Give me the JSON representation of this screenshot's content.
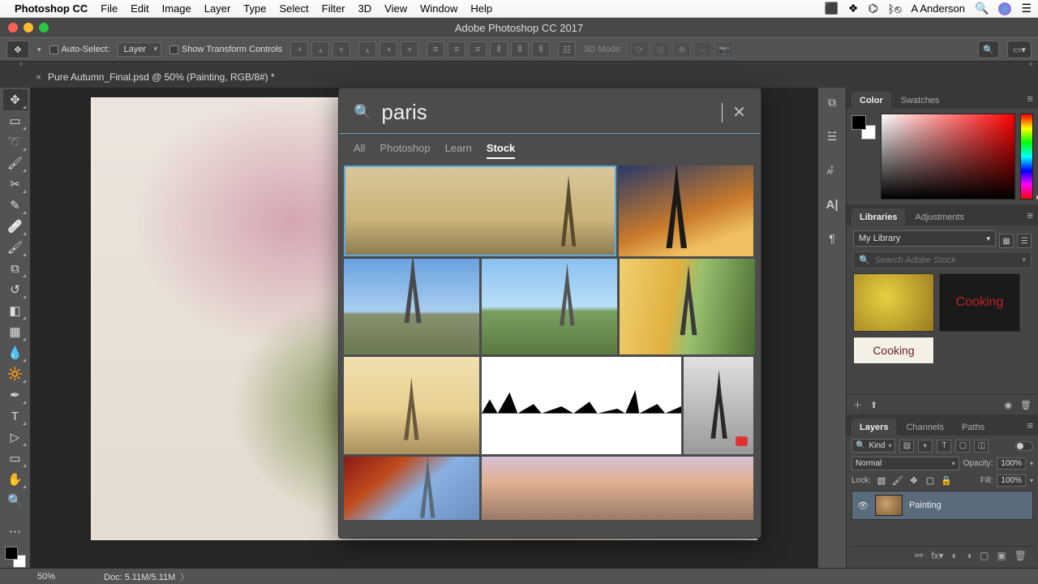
{
  "menubar": {
    "app_name": "Photoshop CC",
    "items": [
      "File",
      "Edit",
      "Image",
      "Layer",
      "Type",
      "Select",
      "Filter",
      "3D",
      "View",
      "Window",
      "Help"
    ],
    "user": "A Anderson"
  },
  "window": {
    "title": "Adobe Photoshop CC 2017"
  },
  "options_bar": {
    "auto_select_label": "Auto-Select:",
    "auto_select_target": "Layer",
    "show_transform_label": "Show Transform Controls",
    "threeD_label": "3D Mode:"
  },
  "doc_tab": {
    "label": "Pure Autumn_Final.psd @ 50% (Painting, RGB/8#) *"
  },
  "search_panel": {
    "query": "paris",
    "tabs": [
      "All",
      "Photoshop",
      "Learn",
      "Stock"
    ],
    "active_tab": 3
  },
  "panels": {
    "color_tabs": [
      "Color",
      "Swatches"
    ],
    "libraries_tabs": [
      "Libraries",
      "Adjustments"
    ],
    "library_name": "My Library",
    "library_search_placeholder": "Search Adobe Stock",
    "lib_item_cooking": "Cooking",
    "lib_item_cooking2": "Cooking",
    "layers_tabs": [
      "Layers",
      "Channels",
      "Paths"
    ],
    "layers_kind": "Kind",
    "layers_blend": "Normal",
    "opacity_label": "Opacity:",
    "opacity_value": "100%",
    "lock_label": "Lock:",
    "fill_label": "Fill:",
    "fill_value": "100%",
    "layer_name": "Painting"
  },
  "statusbar": {
    "zoom": "50%",
    "doc_info": "Doc: 5.11M/5.11M"
  }
}
